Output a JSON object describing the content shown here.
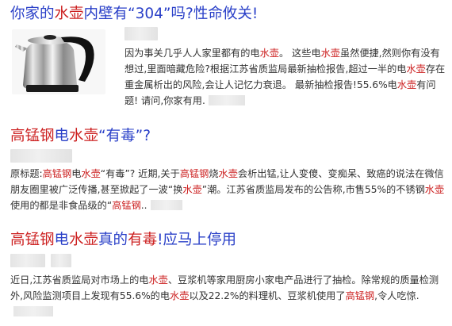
{
  "results": [
    {
      "title": [
        "你家的",
        "水壶",
        "内壁有“304”吗?性命攸关!"
      ],
      "snippet": [
        "因为事关几乎人人家里都有的电",
        "水壶",
        "。 这些电",
        "水壶",
        "虽然便捷,然则你有没有想过,里面暗藏危险?根据江苏省质监局最新抽检报告,超过一半的电",
        "水壶",
        "存在重金属析出的风险,会让人记忆力衰退。 最新抽检报告!55.6%电",
        "水壶",
        "有问题! 请问,你家有用."
      ],
      "thumbnail_icon": "electric-kettle-image"
    },
    {
      "title": [
        "高锰钢",
        "电",
        "水壶",
        "“有毒”?"
      ],
      "snippet": [
        "原标题:",
        "高锰钢",
        "电",
        "水壶",
        "“有毒”? 近期,关于",
        "高锰钢",
        "烧",
        "水壶",
        "会析出锰,让人变傻、变痴呆、致癌的说法在微信朋友圈里被广泛传播,甚至掀起了一波“换",
        "水壶",
        "”潮。江苏省质监局发布的公告称,市售55%的不锈钢",
        "水壶",
        "使用的都是非食品级的“",
        "高锰钢",
        ".."
      ]
    },
    {
      "title": [
        "高锰钢",
        "电",
        "水壶",
        "真的",
        "有毒",
        "!应马上停用"
      ],
      "snippet": [
        "近日,江苏省质监局对市场上的电",
        "水壶",
        "、豆浆机等家用厨房小家电产品进行了抽检。除常规的质量检测外,风险监测项目上发现有55.6%的电",
        "水壶",
        "以及22.2%的料理机、豆浆机使用了",
        "高锰钢",
        ",令人吃惊."
      ]
    }
  ],
  "colors": {
    "link": "#2a40c8",
    "highlight": "#cc2020",
    "text": "#333333"
  }
}
